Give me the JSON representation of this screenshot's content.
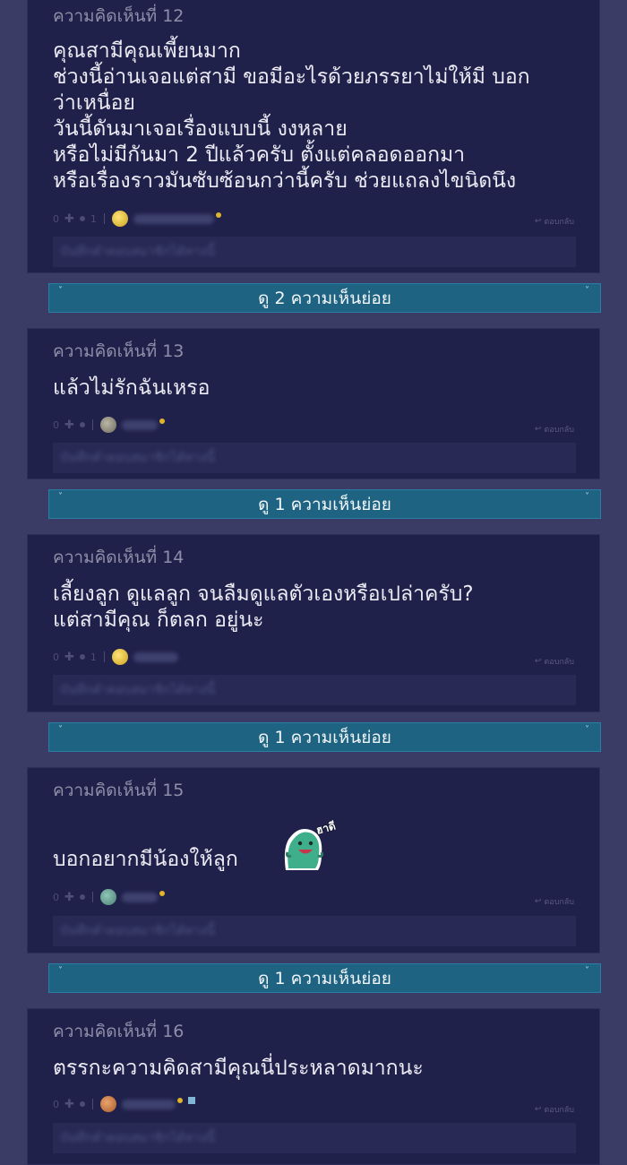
{
  "comments": [
    {
      "header": "ความคิดเห็นที่ 12",
      "body": "คุณสามีคุณเพี้ยนมาก\nช่วงนี้อ่านเจอแต่สามี ขอมีอะไรด้วยภรรยาไม่ให้มี บอก\nว่าเหนื่อย\nวันนี้ดันมาเจอเรื่องแบบนี้ งงหลาย\nหรือไม่มีกันมา 2 ปีแล้วครับ ตั้งแต่คลอดออกมา\nหรือเรื่องราวมันซับซ้อนกว่านี้ครับ ช่วยแถลงไขนิดนึง",
      "likes": "0",
      "emotions": "1",
      "reply_label": "ตอบกลับ",
      "reply_placeholder": "บันทึกคำตอบสมาชิกได้ทางนี้"
    },
    {
      "header": "ความคิดเห็นที่ 13",
      "body": "แล้วไม่รักฉันเหรอ",
      "likes": "0",
      "reply_label": "ตอบกลับ",
      "reply_placeholder": "บันทึกคำตอบสมาชิกได้ทางนี้"
    },
    {
      "header": "ความคิดเห็นที่ 14",
      "body": "เลี้ยงลูก ดูแลลูก จนลืมดูแลตัวเองหรือเปล่าครับ?\nแต่สามีคุณ ก็ตลก อยู่นะ",
      "likes": "0",
      "emotions": "1",
      "reply_label": "ตอบกลับ",
      "reply_placeholder": "บันทึกคำตอบสมาชิกได้ทางนี้"
    },
    {
      "header": "ความคิดเห็นที่ 15",
      "body": "บอกอยากมีน้องให้ลูก",
      "likes": "0",
      "reply_label": "ตอบกลับ",
      "reply_placeholder": "บันทึกคำตอบสมาชิกได้ทางนี้",
      "sticker_text": "ฮาดี"
    },
    {
      "header": "ความคิดเห็นที่ 16",
      "body": "ตรรกะความคิดสามีคุณนี่ประหลาดมากนะ",
      "likes": "0",
      "reply_label": "ตอบกลับ",
      "reply_placeholder": "บันทึกคำตอบสมาชิกได้ทางนี้"
    }
  ],
  "expanders": [
    {
      "label": "ดู 2 ความเห็นย่อย"
    },
    {
      "label": "ดู 1 ความเห็นย่อย"
    },
    {
      "label": "ดู 1 ความเห็นย่อย"
    },
    {
      "label": "ดู 1 ความเห็นย่อย"
    }
  ],
  "icons": {
    "plus": "plus-icon",
    "emotion_dot": "emotion-icon",
    "reply": "reply-icon",
    "chevron": "chevron-down-icon"
  }
}
